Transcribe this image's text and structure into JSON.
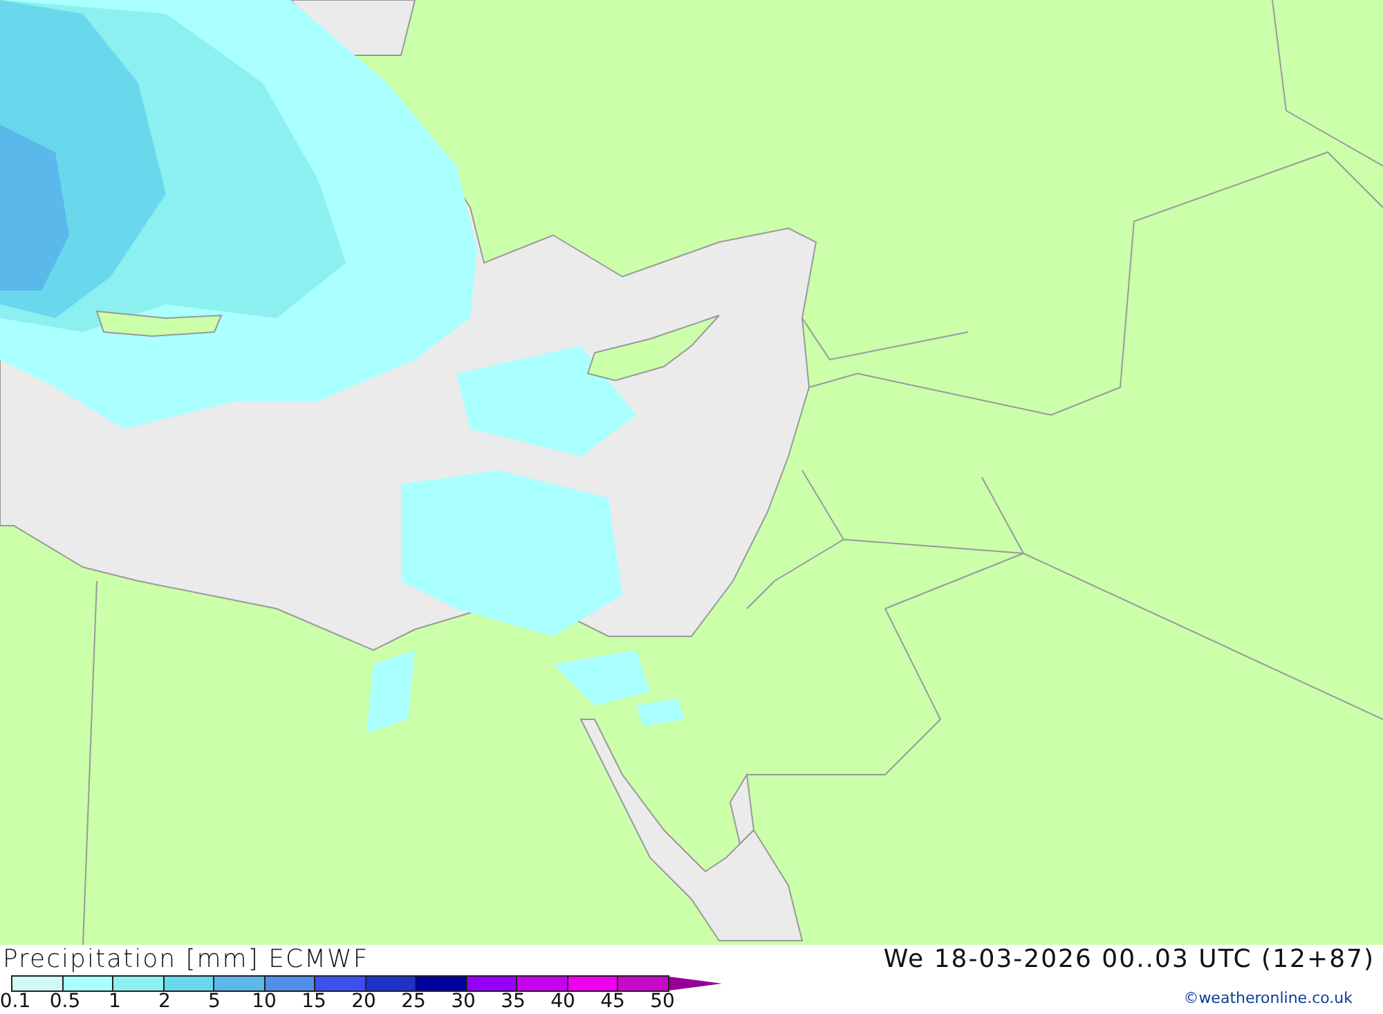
{
  "title": "Precipitation [mm] ECMWF",
  "valid_time": "We 18-03-2026 00..03 UTC (12+87)",
  "legend": {
    "bins": [
      {
        "color": "#d2f7f7"
      },
      {
        "color": "#aaffff"
      },
      {
        "color": "#8cf0f0"
      },
      {
        "color": "#6ad8ec"
      },
      {
        "color": "#5ab8ea"
      },
      {
        "color": "#5090e8"
      },
      {
        "color": "#3c50f0"
      },
      {
        "color": "#1e32c8"
      },
      {
        "color": "#0000a0"
      },
      {
        "color": "#9600fa"
      },
      {
        "color": "#c800f0"
      },
      {
        "color": "#f000f0"
      },
      {
        "color": "#c80ac8"
      },
      {
        "kind": "arrow",
        "color": "#960096"
      }
    ],
    "labels": [
      "0.1",
      "0.5",
      "1",
      "2",
      "5",
      "10",
      "15",
      "20",
      "25",
      "30",
      "35",
      "40",
      "45",
      "50"
    ]
  },
  "copyright": "©weatheronline.co.uk"
}
